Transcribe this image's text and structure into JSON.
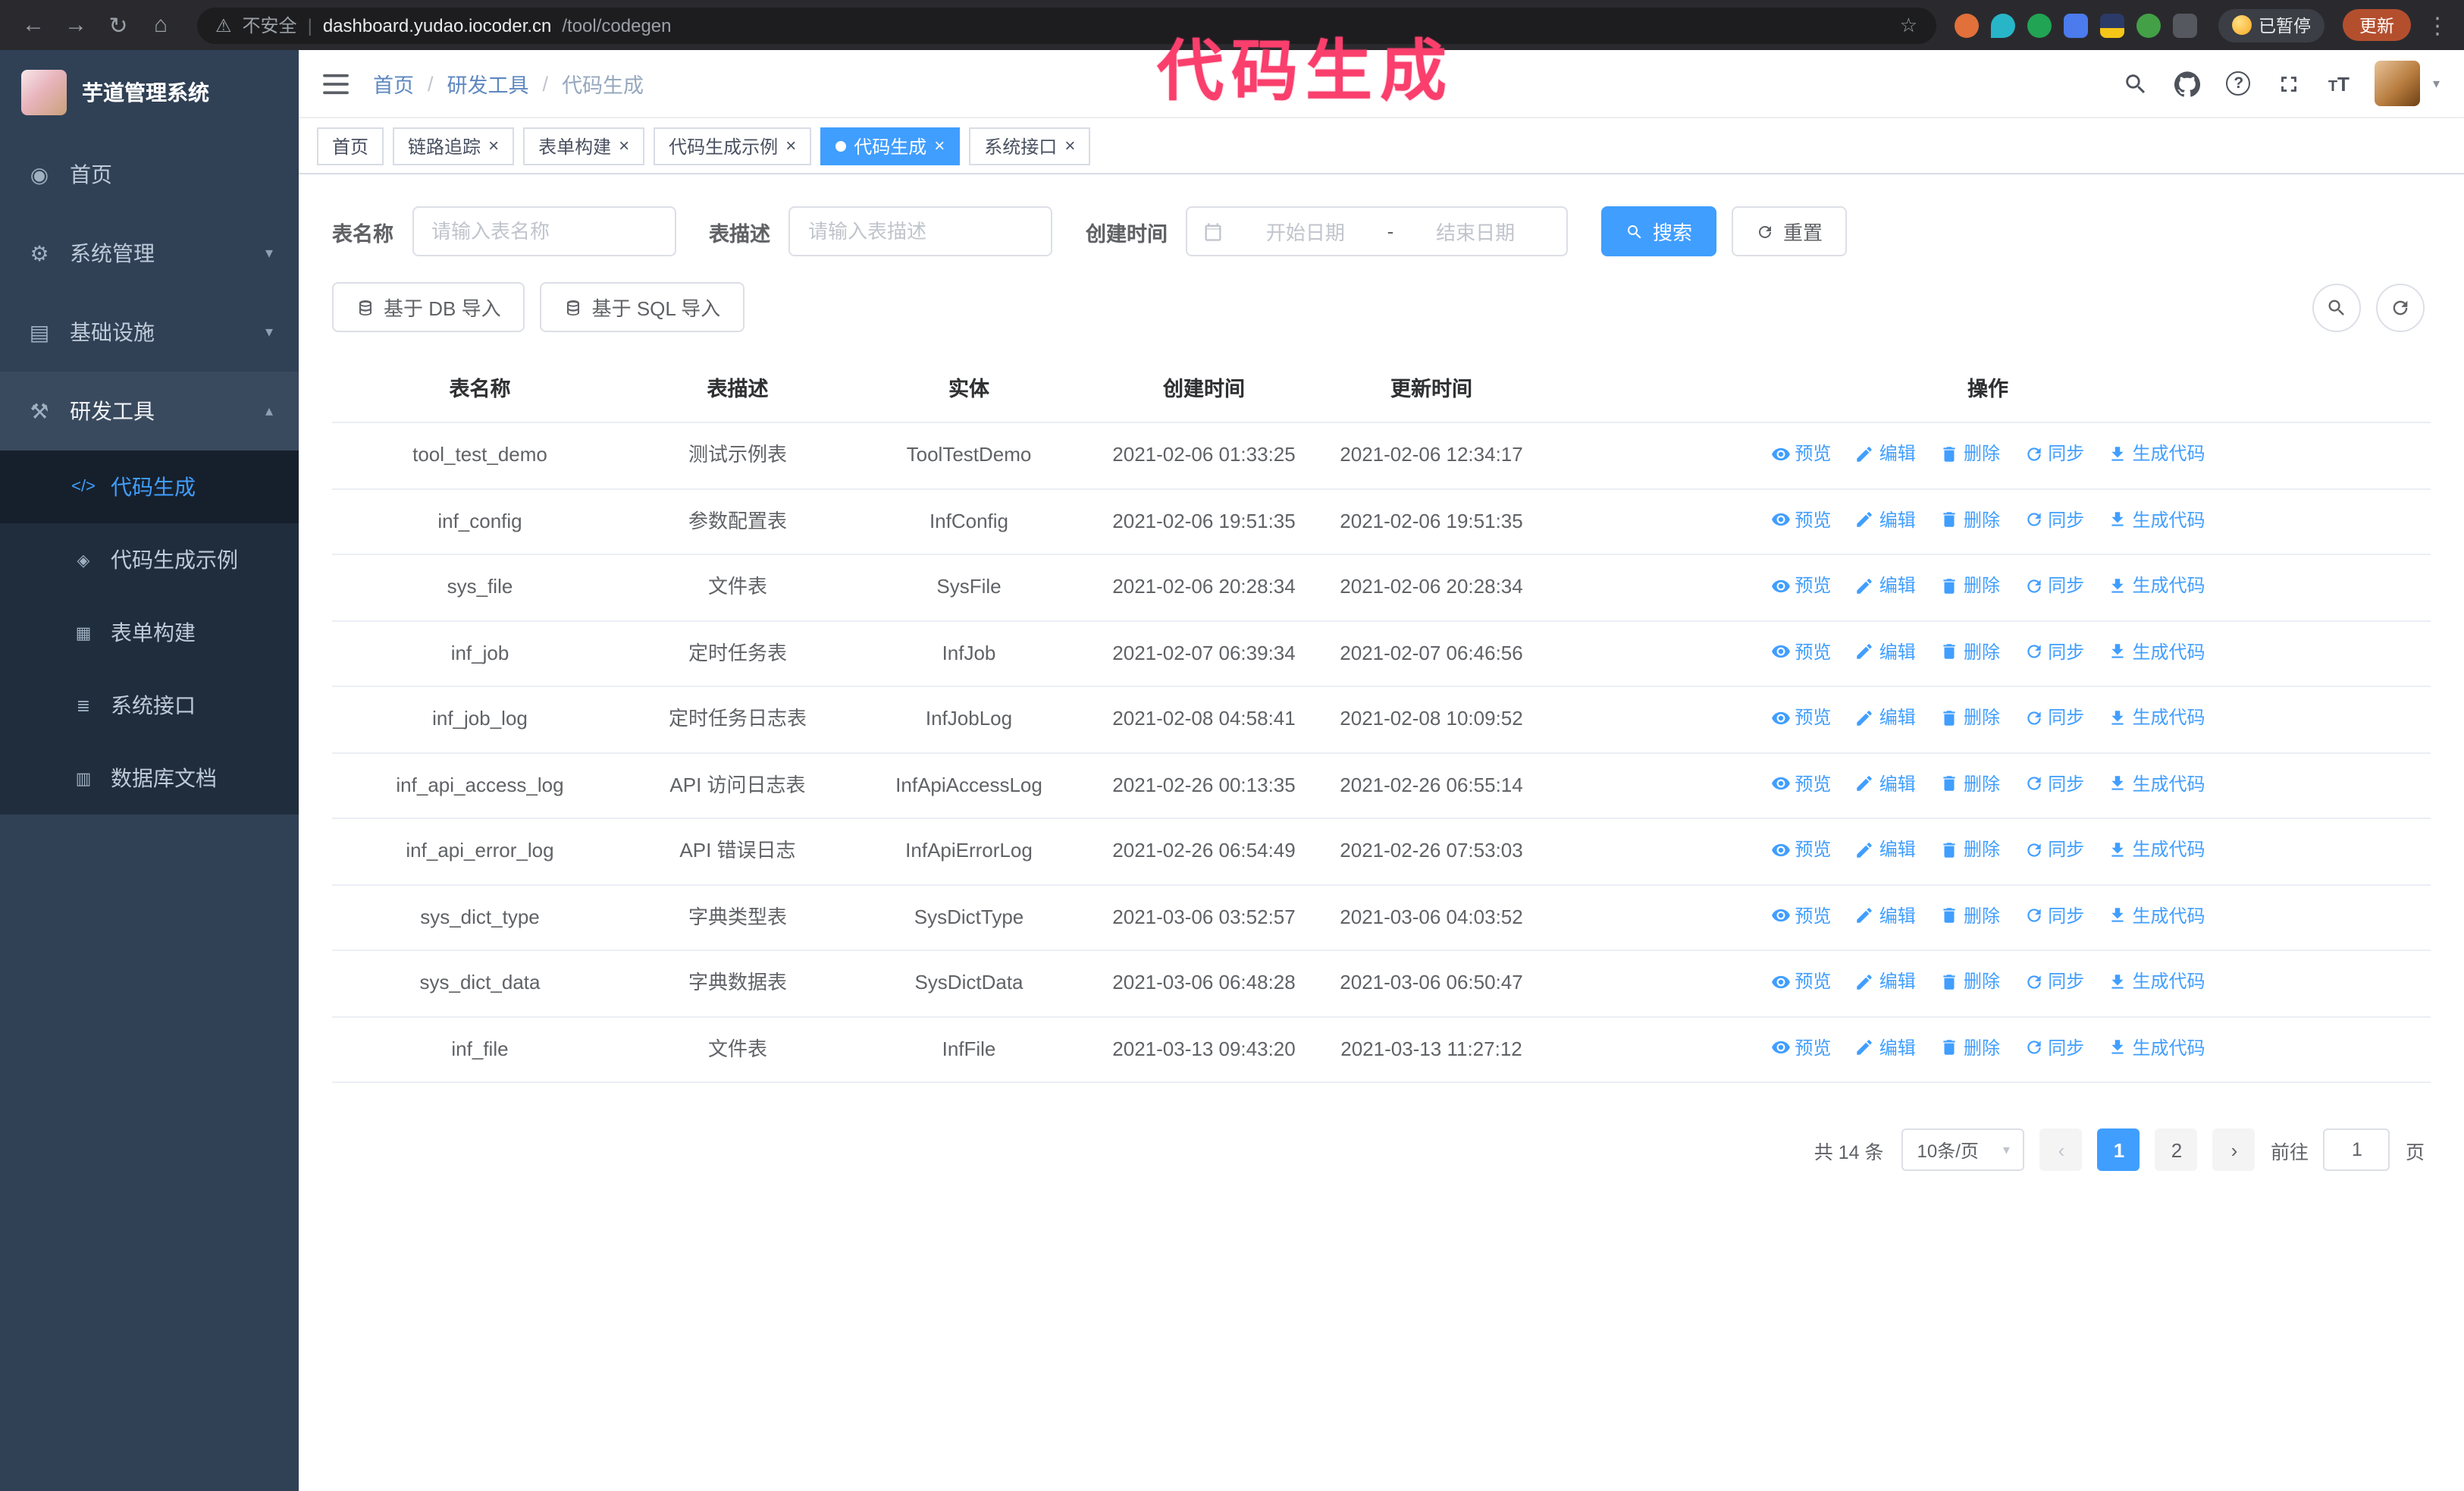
{
  "annotation": {
    "text": "代码生成"
  },
  "browser": {
    "security_label": "不安全",
    "url_host": "dashboard.yudao.iocoder.cn",
    "url_path": "/tool/codegen",
    "paused_badge": "已暂停",
    "update_button": "更新"
  },
  "icons": {
    "back": "←",
    "forward": "→",
    "reload": "↻",
    "home": "⌂",
    "warning": "⚠",
    "divider": "|",
    "star": "☆",
    "kebab": "⋮",
    "menu_home": "◉",
    "menu_system": "⚙",
    "menu_infra": "▤",
    "menu_tools": "⚒",
    "sub_codegen": "</>",
    "sub_demo": "◈",
    "sub_form": "▦",
    "sub_api": "≣",
    "sub_db": "▥",
    "chevron_down": "▾",
    "chevron_up": "▴",
    "caret_down": "▾",
    "close": "×",
    "prev": "‹",
    "next": "›",
    "range_sep": "-"
  },
  "app": {
    "logo_title": "芋道管理系统",
    "sidebar": {
      "items": [
        {
          "label": "首页"
        },
        {
          "label": "系统管理"
        },
        {
          "label": "基础设施"
        },
        {
          "label": "研发工具"
        }
      ],
      "subitems": [
        {
          "label": "代码生成"
        },
        {
          "label": "代码生成示例"
        },
        {
          "label": "表单构建"
        },
        {
          "label": "系统接口"
        },
        {
          "label": "数据库文档"
        }
      ]
    },
    "breadcrumb": {
      "separator": "/",
      "items": [
        "首页",
        "研发工具",
        "代码生成"
      ]
    },
    "tabs": [
      {
        "label": "首页"
      },
      {
        "label": "链路追踪"
      },
      {
        "label": "表单构建"
      },
      {
        "label": "代码生成示例"
      },
      {
        "label": "代码生成"
      },
      {
        "label": "系统接口"
      }
    ],
    "filters": {
      "table_name_label": "表名称",
      "table_name_placeholder": "请输入表名称",
      "table_desc_label": "表描述",
      "table_desc_placeholder": "请输入表描述",
      "create_time_label": "创建时间",
      "date_start_placeholder": "开始日期",
      "date_end_placeholder": "结束日期",
      "search_button": "搜索",
      "reset_button": "重置"
    },
    "toolbar": {
      "import_db": "基于 DB 导入",
      "import_sql": "基于 SQL 导入"
    },
    "table": {
      "columns": [
        "表名称",
        "表描述",
        "实体",
        "创建时间",
        "更新时间",
        "操作"
      ],
      "actions": [
        "预览",
        "编辑",
        "删除",
        "同步",
        "生成代码"
      ],
      "rows": [
        {
          "name": "tool_test_demo",
          "desc": "测试示例表",
          "entity": "ToolTestDemo",
          "created": "2021-02-06 01:33:25",
          "updated": "2021-02-06 12:34:17"
        },
        {
          "name": "inf_config",
          "desc": "参数配置表",
          "entity": "InfConfig",
          "created": "2021-02-06 19:51:35",
          "updated": "2021-02-06 19:51:35"
        },
        {
          "name": "sys_file",
          "desc": "文件表",
          "entity": "SysFile",
          "created": "2021-02-06 20:28:34",
          "updated": "2021-02-06 20:28:34"
        },
        {
          "name": "inf_job",
          "desc": "定时任务表",
          "entity": "InfJob",
          "created": "2021-02-07 06:39:34",
          "updated": "2021-02-07 06:46:56"
        },
        {
          "name": "inf_job_log",
          "desc": "定时任务日志表",
          "entity": "InfJobLog",
          "created": "2021-02-08 04:58:41",
          "updated": "2021-02-08 10:09:52"
        },
        {
          "name": "inf_api_access_log",
          "desc": "API 访问日志表",
          "entity": "InfApiAccessLog",
          "created": "2021-02-26 00:13:35",
          "updated": "2021-02-26 06:55:14"
        },
        {
          "name": "inf_api_error_log",
          "desc": "API 错误日志",
          "entity": "InfApiErrorLog",
          "created": "2021-02-26 06:54:49",
          "updated": "2021-02-26 07:53:03"
        },
        {
          "name": "sys_dict_type",
          "desc": "字典类型表",
          "entity": "SysDictType",
          "created": "2021-03-06 03:52:57",
          "updated": "2021-03-06 04:03:52"
        },
        {
          "name": "sys_dict_data",
          "desc": "字典数据表",
          "entity": "SysDictData",
          "created": "2021-03-06 06:48:28",
          "updated": "2021-03-06 06:50:47"
        },
        {
          "name": "inf_file",
          "desc": "文件表",
          "entity": "InfFile",
          "created": "2021-03-13 09:43:20",
          "updated": "2021-03-13 11:27:12"
        }
      ]
    },
    "pagination": {
      "total": "共 14 条",
      "page_size": "10条/页",
      "pages": [
        "1",
        "2"
      ],
      "goto_label": "前往",
      "goto_value": "1",
      "goto_suffix": "页"
    }
  }
}
